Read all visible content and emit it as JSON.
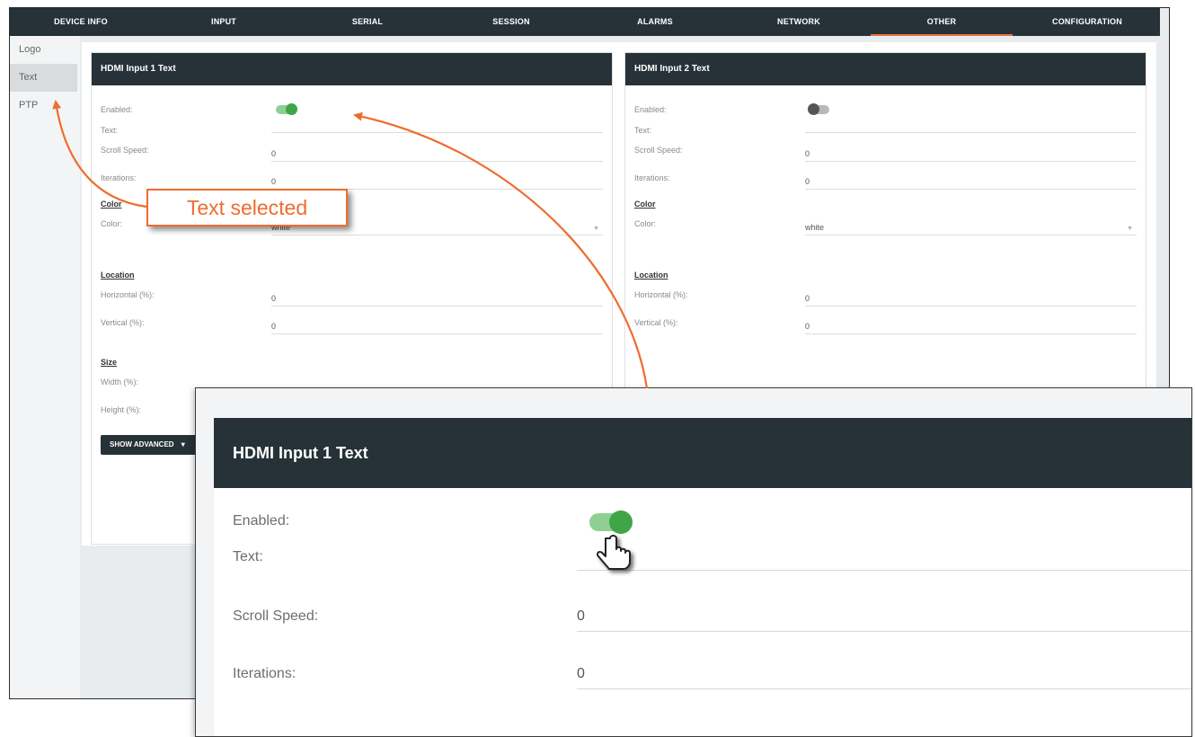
{
  "nav": {
    "tabs": [
      {
        "label": "DEVICE INFO"
      },
      {
        "label": "INPUT"
      },
      {
        "label": "SERIAL"
      },
      {
        "label": "SESSION"
      },
      {
        "label": "ALARMS"
      },
      {
        "label": "NETWORK"
      },
      {
        "label": "OTHER"
      },
      {
        "label": "CONFIGURATION"
      }
    ],
    "active_tab": "OTHER"
  },
  "sidebar": {
    "items": [
      {
        "label": "Logo"
      },
      {
        "label": "Text"
      },
      {
        "label": "PTP"
      }
    ],
    "selected": "Text"
  },
  "panels": [
    {
      "title": "HDMI Input 1 Text",
      "enabled_label": "Enabled:",
      "enabled": true,
      "text_label": "Text:",
      "text_value": "",
      "scroll_speed_label": "Scroll Speed:",
      "scroll_speed": "0",
      "iterations_label": "Iterations:",
      "iterations": "0",
      "color_section": "Color",
      "color_label": "Color:",
      "color_value": "white",
      "location_section": "Location",
      "horizontal_label": "Horizontal (%):",
      "horizontal": "0",
      "vertical_label": "Vertical (%):",
      "vertical": "0",
      "size_section": "Size",
      "width_label": "Width (%):",
      "height_label": "Height (%):",
      "advanced_button": "SHOW ADVANCED"
    },
    {
      "title": "HDMI Input 2 Text",
      "enabled_label": "Enabled:",
      "enabled": false,
      "text_label": "Text:",
      "text_value": "",
      "scroll_speed_label": "Scroll Speed:",
      "scroll_speed": "0",
      "iterations_label": "Iterations:",
      "iterations": "0",
      "color_section": "Color",
      "color_label": "Color:",
      "color_value": "white",
      "location_section": "Location",
      "horizontal_label": "Horizontal (%):",
      "horizontal": "0",
      "vertical_label": "Vertical (%):",
      "vertical": "0"
    }
  ],
  "callout": {
    "text": "Text selected"
  },
  "zoom": {
    "title": "HDMI Input 1 Text",
    "enabled_label": "Enabled:",
    "text_label": "Text:",
    "scroll_speed_label": "Scroll Speed:",
    "scroll_speed": "0",
    "iterations_label": "Iterations:",
    "iterations": "0"
  },
  "colors": {
    "header_bg": "#263238",
    "accent_orange": "#ef6c2f",
    "toggle_on": "#3fa548"
  }
}
